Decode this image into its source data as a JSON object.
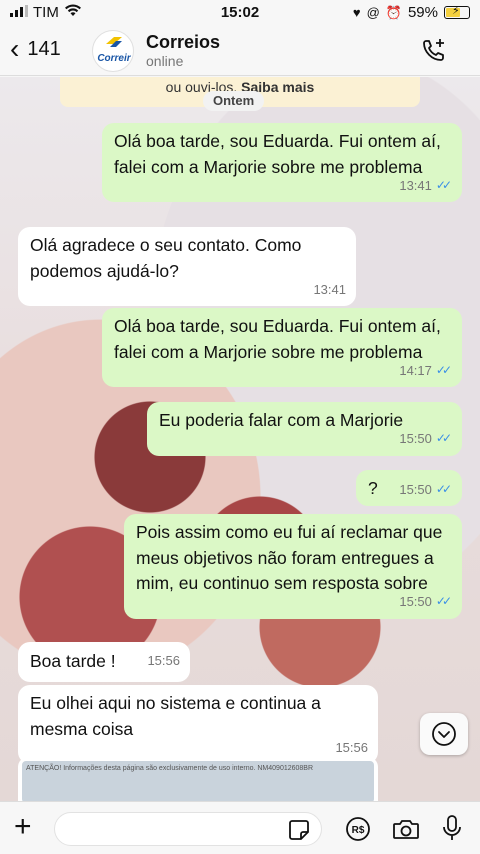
{
  "status_bar": {
    "carrier": "TIM",
    "time": "15:02",
    "battery": "59%"
  },
  "header": {
    "back_count": "141",
    "contact_name": "Correios",
    "contact_status": "online",
    "avatar_text": "Correir"
  },
  "chat": {
    "notice_text": "ou ouvi-los. ",
    "notice_link": "Saiba mais",
    "date_chip": "Ontem",
    "messages": [
      {
        "dir": "out",
        "text": "Olá boa tarde, sou Eduarda. Fui ontem aí, falei com a Marjorie sobre me problema",
        "time": "13:41",
        "read": true
      },
      {
        "dir": "in",
        "text": "Olá agradece o seu contato. Como podemos ajudá-lo?",
        "time": "13:41"
      },
      {
        "dir": "out",
        "text": "Olá boa tarde, sou Eduarda. Fui ontem aí, falei com a Marjorie sobre me problema",
        "time": "14:17",
        "read": true
      },
      {
        "dir": "out",
        "text": "Eu poderia falar com a Marjorie",
        "time": "15:50",
        "read": true
      },
      {
        "dir": "out",
        "text": "?",
        "time": "15:50",
        "read": true
      },
      {
        "dir": "out",
        "text": "Pois assim como eu fui aí reclamar que meus objetivos não foram entregues a mim, eu continuo sem resposta sobre",
        "time": "15:50",
        "read": true
      },
      {
        "dir": "in",
        "text": "Boa tarde !",
        "time": "15:56"
      },
      {
        "dir": "in",
        "text": "Eu olhei aqui no sistema e continua a mesma coisa",
        "time": "15:56"
      }
    ],
    "doc_preview_text": "ATENÇÃO! Informações desta página são exclusivamente de uso interno. NM409012608BR"
  },
  "icons": {
    "wifi": "wifi-icon",
    "call": "add-call-icon",
    "scroll": "chevron-down-icon",
    "plus": "plus-icon",
    "sticker": "sticker-icon",
    "pay": "payment-icon",
    "camera": "camera-icon",
    "mic": "microphone-icon"
  },
  "colors": {
    "outgoing_bubble": "#dbf8c6",
    "incoming_bubble": "#ffffff",
    "read_ticks": "#3b8fe6"
  }
}
